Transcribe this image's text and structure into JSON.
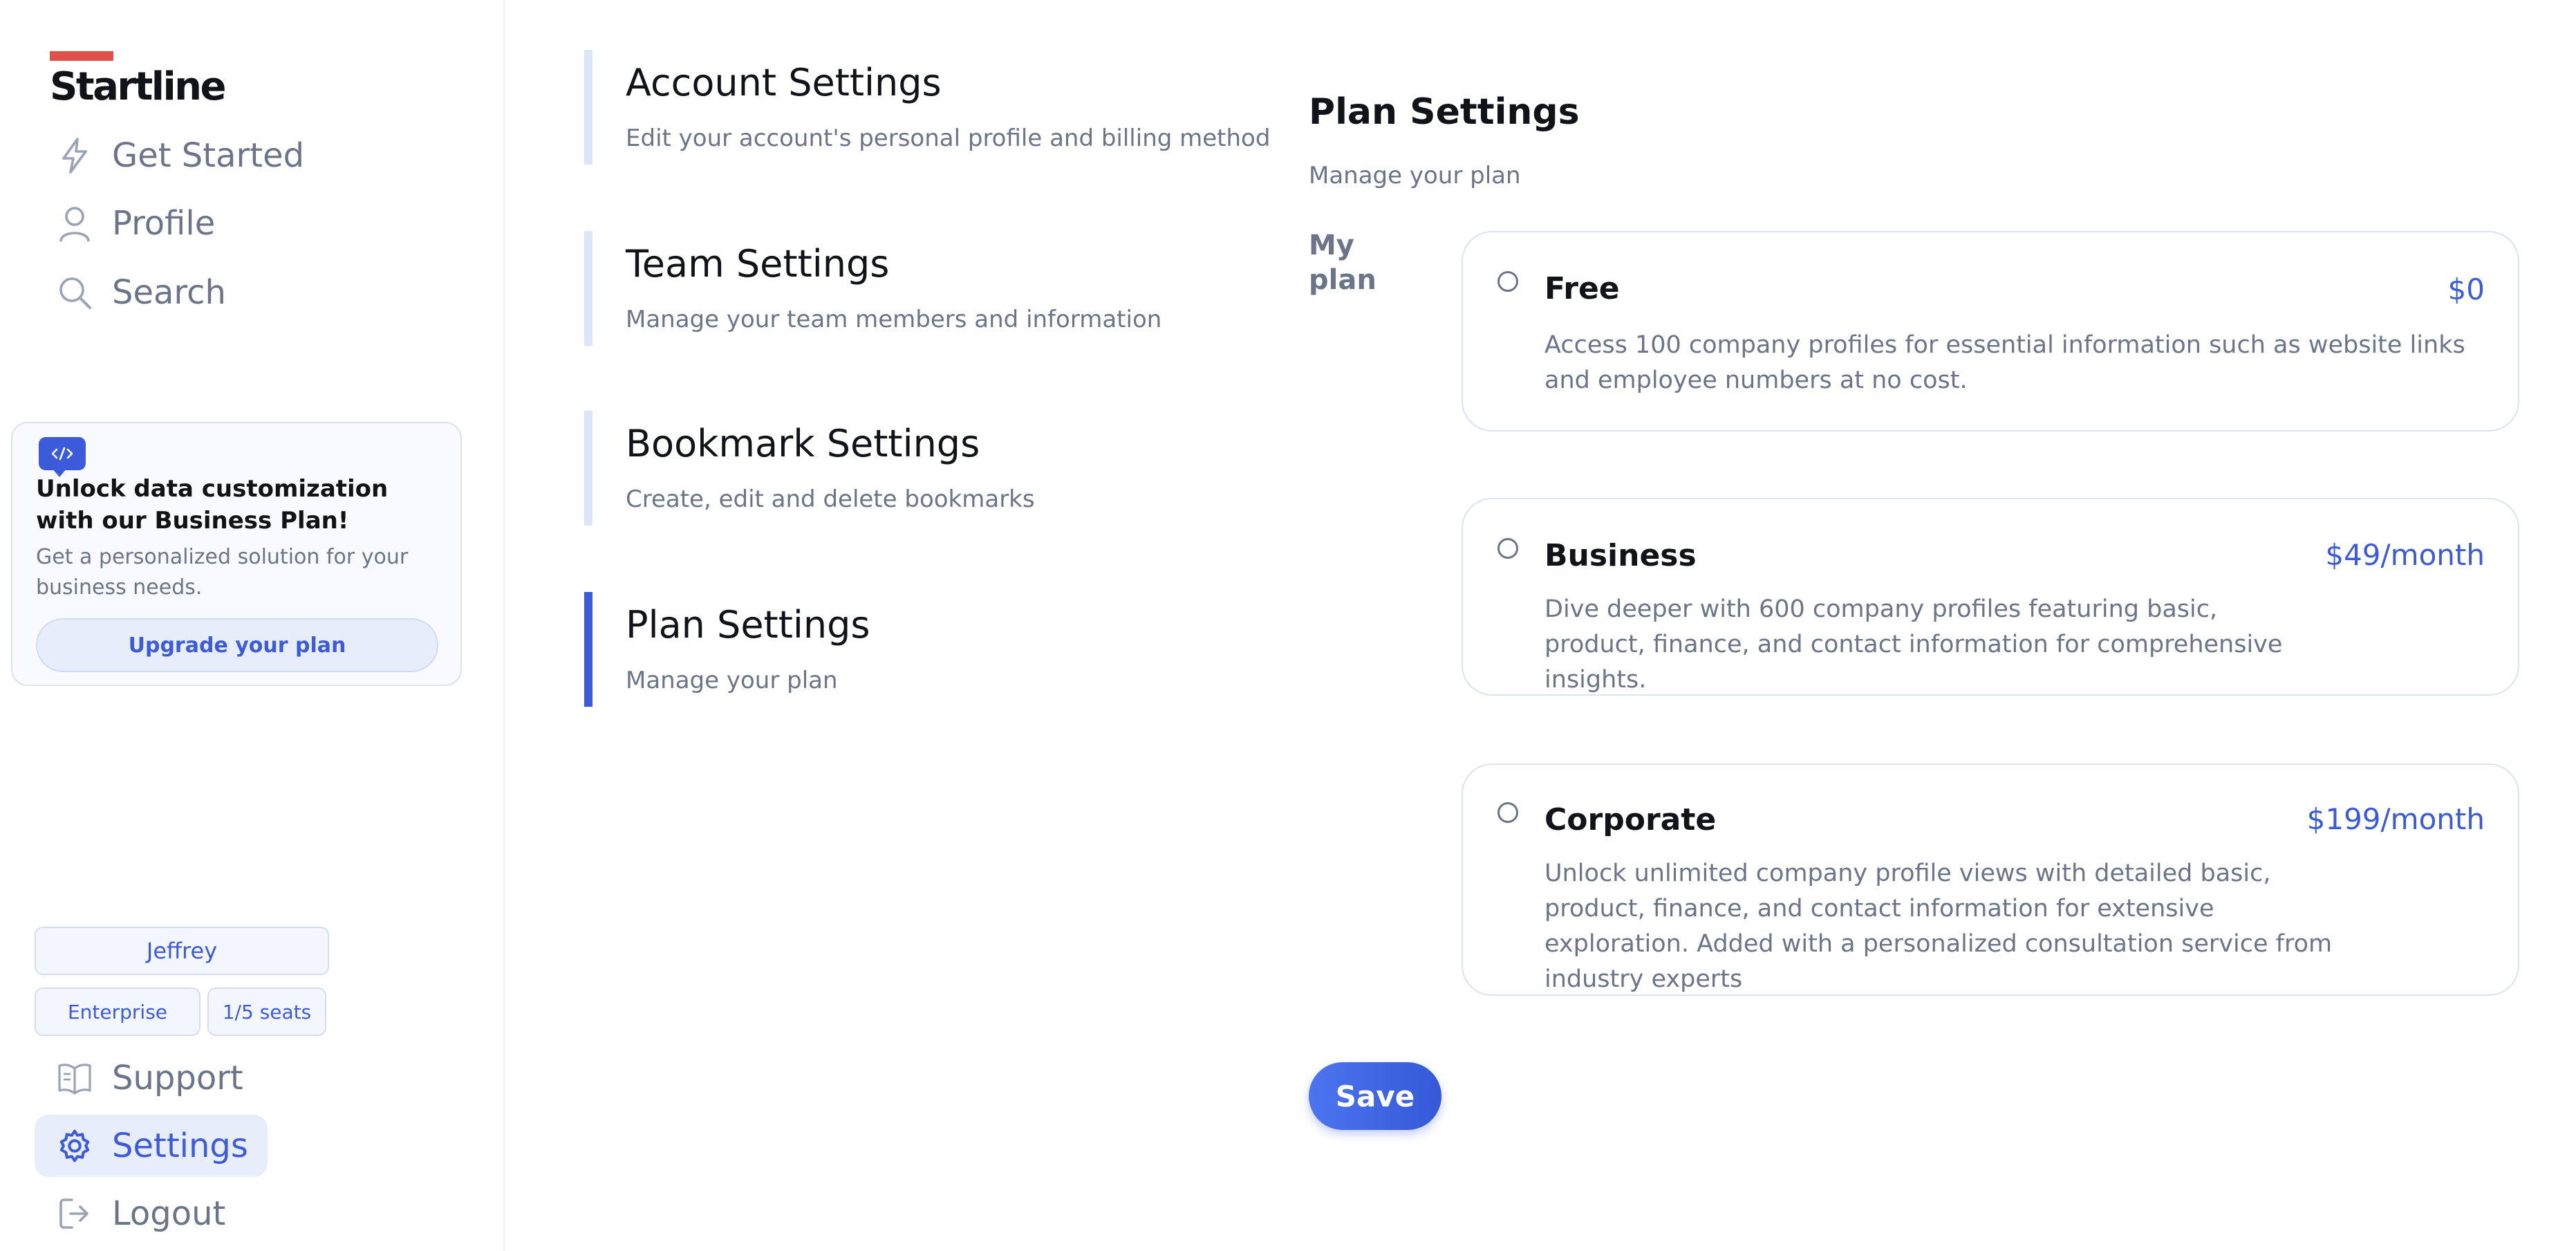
{
  "brand": {
    "name": "Startline",
    "accent": "#e0504b"
  },
  "colors": {
    "primary": "#3b5bdb",
    "muted": "#6b7489",
    "heading": "#111318"
  },
  "sidebar": {
    "nav": [
      {
        "label": "Get Started",
        "icon": "lightning-icon"
      },
      {
        "label": "Profile",
        "icon": "user-icon"
      },
      {
        "label": "Search",
        "icon": "search-icon"
      }
    ],
    "promo": {
      "icon": "code-chat-icon",
      "title": "Unlock data customization with our Business Plan!",
      "description": "Get a personalized solution for your business needs.",
      "button": "Upgrade your plan"
    },
    "account": {
      "user": "Jeffrey",
      "plan": "Enterprise",
      "seats": "1/5 seats"
    },
    "bottom_nav": [
      {
        "label": "Support",
        "icon": "book-icon",
        "active": false
      },
      {
        "label": "Settings",
        "icon": "gear-icon",
        "active": true
      },
      {
        "label": "Logout",
        "icon": "logout-icon",
        "active": false
      }
    ]
  },
  "settings_sections": [
    {
      "title": "Account Settings",
      "description": "Edit your account's personal profile and billing method",
      "active": false
    },
    {
      "title": "Team Settings",
      "description": "Manage your team members and information",
      "active": false
    },
    {
      "title": "Bookmark Settings",
      "description": "Create, edit and delete bookmarks",
      "active": false
    },
    {
      "title": "Plan Settings",
      "description": "Manage your plan",
      "active": true
    }
  ],
  "plan_panel": {
    "title": "Plan Settings",
    "subtitle": "Manage your plan",
    "label": "My plan",
    "plans": [
      {
        "name": "Free",
        "price": "$0",
        "description": "Access 100 company profiles for essential information such as website links and employee numbers at no cost.",
        "selected": false
      },
      {
        "name": "Business",
        "price": "$49/month",
        "description": "Dive deeper with 600 company profiles featuring basic, product, finance, and contact information for comprehensive insights.",
        "selected": false
      },
      {
        "name": "Corporate",
        "price": "$199/month",
        "description": "Unlock unlimited company profile views with detailed basic, product, finance, and contact information for extensive exploration. Added with a personalized consultation service from industry experts",
        "selected": false
      }
    ],
    "save_label": "Save"
  }
}
